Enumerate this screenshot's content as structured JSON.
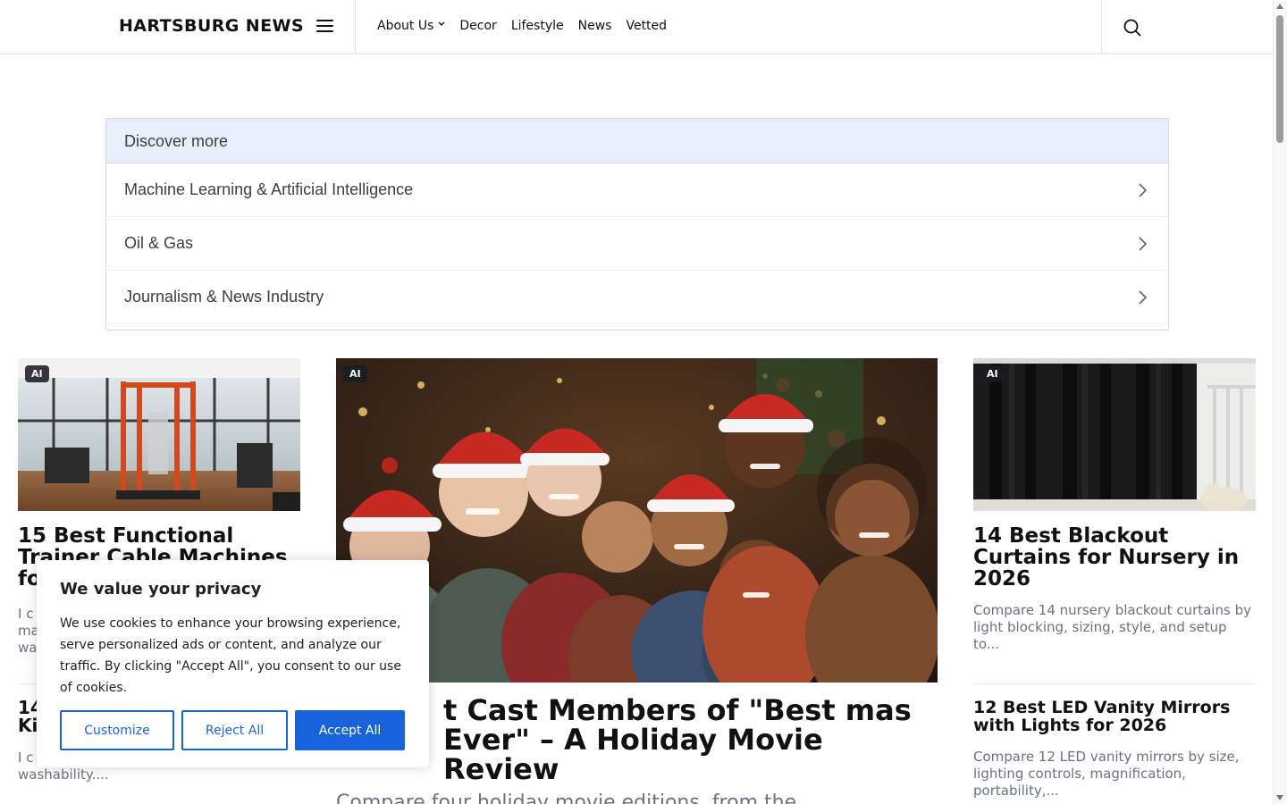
{
  "header": {
    "brand": "HARTSBURG NEWS",
    "nav": [
      {
        "label": "About Us",
        "has_dropdown": true
      },
      {
        "label": "Decor"
      },
      {
        "label": "Lifestyle"
      },
      {
        "label": "News"
      },
      {
        "label": "Vetted"
      }
    ]
  },
  "discover": {
    "heading": "Discover more",
    "items": [
      "Machine Learning & Artificial Intelligence",
      "Oil & Gas",
      "Journalism & News Industry"
    ]
  },
  "articles": {
    "left_top": {
      "badge": "AI",
      "title": "15 Best Functional Trainer Cable Machines fo",
      "excerpt": "I c ma wa"
    },
    "left_bottom": {
      "title": "14 Ki",
      "excerpt": "I c on fabric, closure type, fit, and washability...."
    },
    "feature": {
      "badge": "AI",
      "title": "t Cast Members of \"Best mas Ever\" – A Holiday Movie Review",
      "excerpt": "Compare four holiday movie editions, from the"
    },
    "right_top": {
      "badge": "AI",
      "title": "14 Best Blackout Curtains for Nursery in 2026",
      "excerpt": "Compare 14 nursery blackout curtains by light blocking, sizing, style, and setup to..."
    },
    "right_bottom": {
      "title": "12 Best LED Vanity Mirrors with Lights for 2026",
      "excerpt": "Compare 12 LED vanity mirrors by size, lighting controls, magnification, portability,..."
    }
  },
  "cookie": {
    "title": "We value your privacy",
    "text": "We use cookies to enhance your browsing experience, serve personalized ads or content, and analyze our traffic. By clicking \"Accept All\", you consent to our use of cookies.",
    "customize": "Customize",
    "reject": "Reject All",
    "accept": "Accept All"
  },
  "colors": {
    "accent": "#1863dc",
    "discover_header_bg": "#e8effc"
  }
}
